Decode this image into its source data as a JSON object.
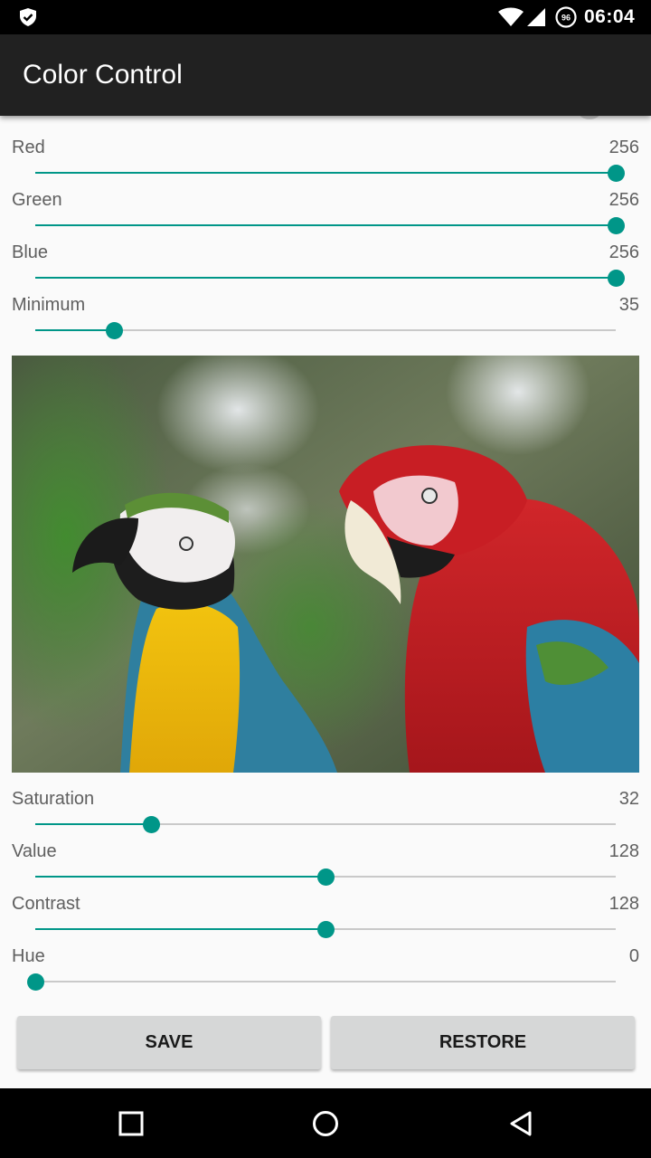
{
  "status_bar": {
    "time": "06:04",
    "battery_level": "96"
  },
  "app_bar": {
    "title": "Color Control"
  },
  "sliders_top": [
    {
      "label": "Red",
      "value": "256",
      "fraction": 1.0
    },
    {
      "label": "Green",
      "value": "256",
      "fraction": 1.0
    },
    {
      "label": "Blue",
      "value": "256",
      "fraction": 1.0
    },
    {
      "label": "Minimum",
      "value": "35",
      "fraction": 0.137
    }
  ],
  "sliders_bottom": [
    {
      "label": "Saturation",
      "value": "32",
      "fraction": 0.2
    },
    {
      "label": "Value",
      "value": "128",
      "fraction": 0.5
    },
    {
      "label": "Contrast",
      "value": "128",
      "fraction": 0.5
    },
    {
      "label": "Hue",
      "value": "0",
      "fraction": 0.0
    }
  ],
  "buttons": {
    "save": "SAVE",
    "restore": "RESTORE"
  },
  "colors": {
    "accent": "#009688",
    "toolbar": "#212121",
    "track": "#c9c9c9"
  }
}
